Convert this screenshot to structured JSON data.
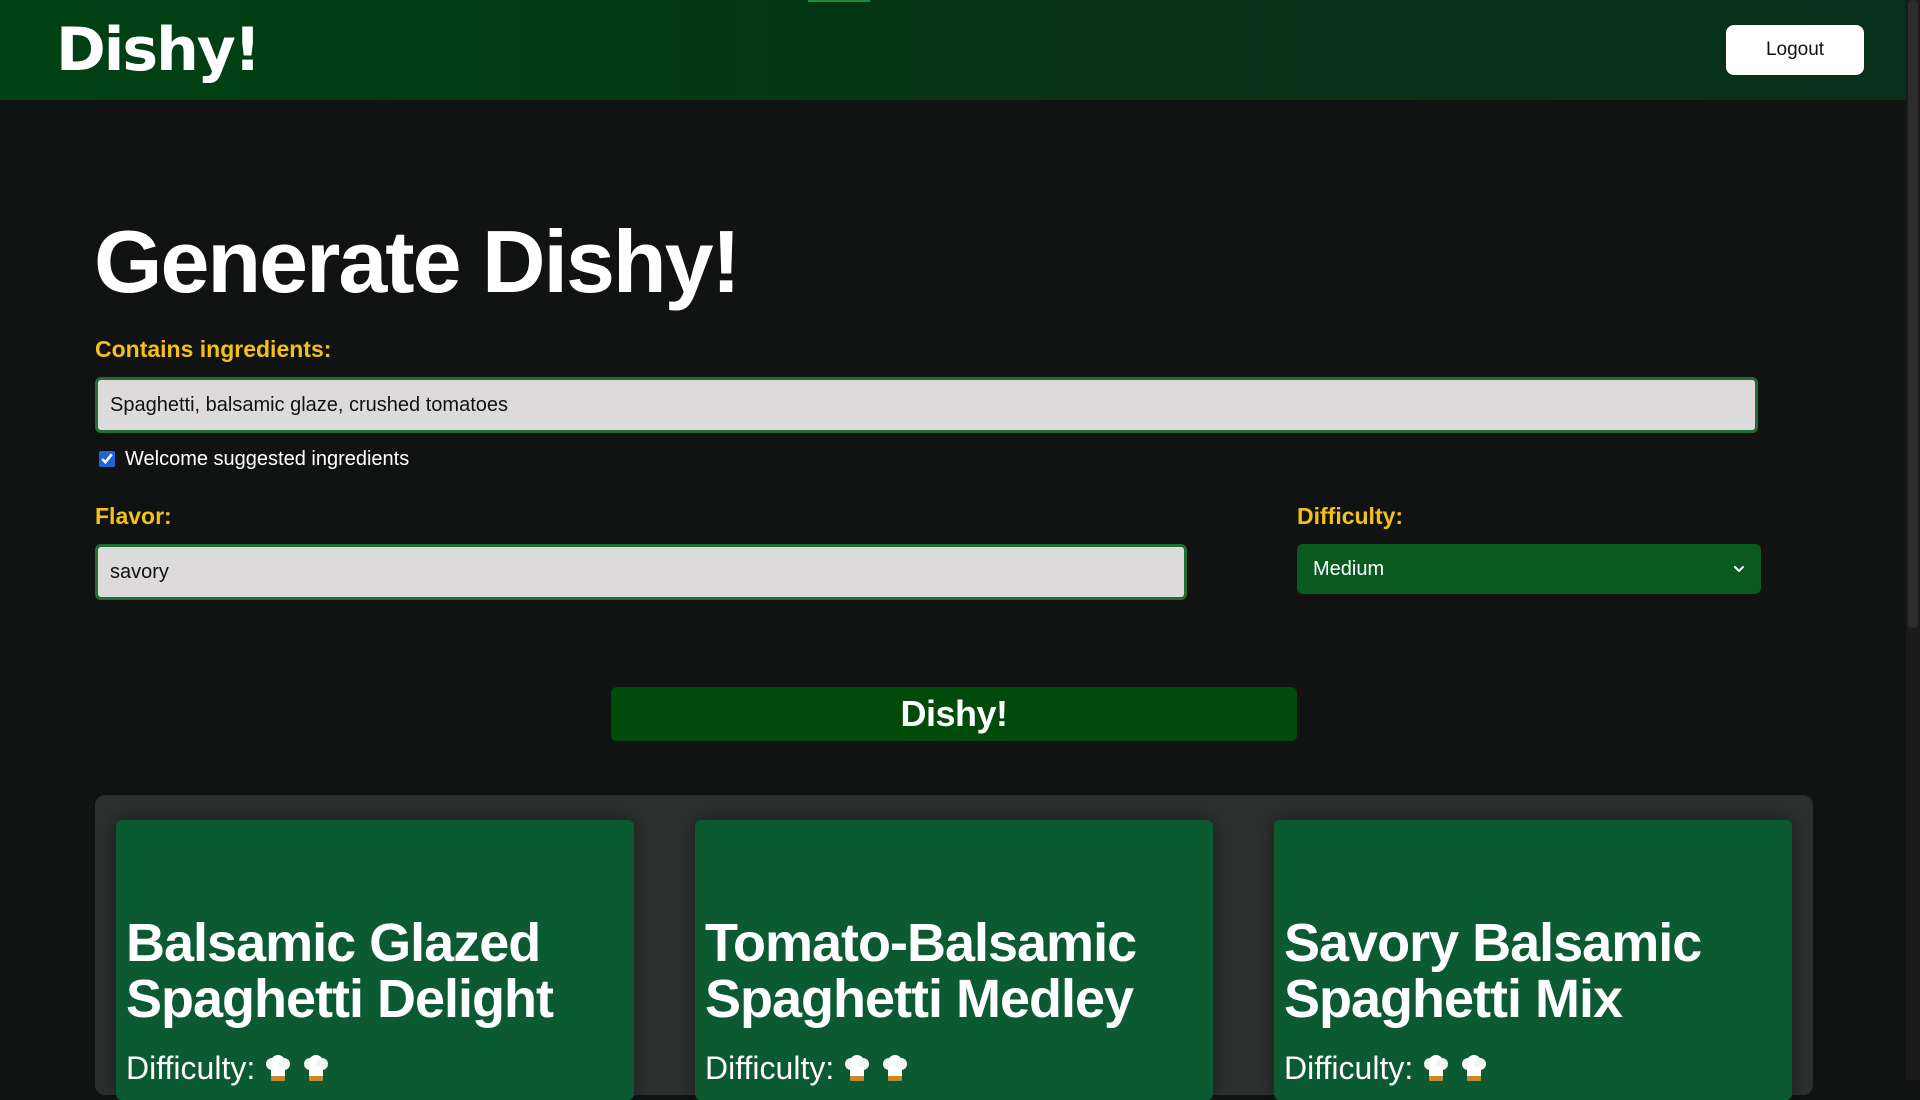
{
  "header": {
    "brand": "Dishy!",
    "logout_label": "Logout"
  },
  "main": {
    "title": "Generate Dishy!",
    "ingredients": {
      "label": "Contains ingredients:",
      "value": "Spaghetti, balsamic glaze, crushed tomatoes"
    },
    "suggested": {
      "label": "Welcome suggested ingredients",
      "checked": true
    },
    "flavor": {
      "label": "Flavor:",
      "value": "savory"
    },
    "difficulty": {
      "label": "Difficulty:",
      "selected": "Medium"
    },
    "submit_label": "Dishy!"
  },
  "results": [
    {
      "title": "Balsamic Glazed Spaghetti Delight",
      "difficulty_label": "Difficulty:",
      "difficulty_icons": [
        "chef-hat-icon",
        "chef-hat-icon"
      ]
    },
    {
      "title": "Tomato-Balsamic Spaghetti Medley",
      "difficulty_label": "Difficulty:",
      "difficulty_icons": [
        "chef-hat-icon",
        "chef-hat-icon"
      ]
    },
    {
      "title": "Savory Balsamic Spaghetti Mix",
      "difficulty_label": "Difficulty:",
      "difficulty_icons": [
        "chef-hat-icon",
        "chef-hat-icon"
      ]
    }
  ],
  "colors": {
    "header_bg": "#004214",
    "label_accent": "#f3c117",
    "button_green": "#004a0a",
    "select_green": "#0a5a1f",
    "card_green": "#0c5a32",
    "page_bg": "#111312"
  }
}
